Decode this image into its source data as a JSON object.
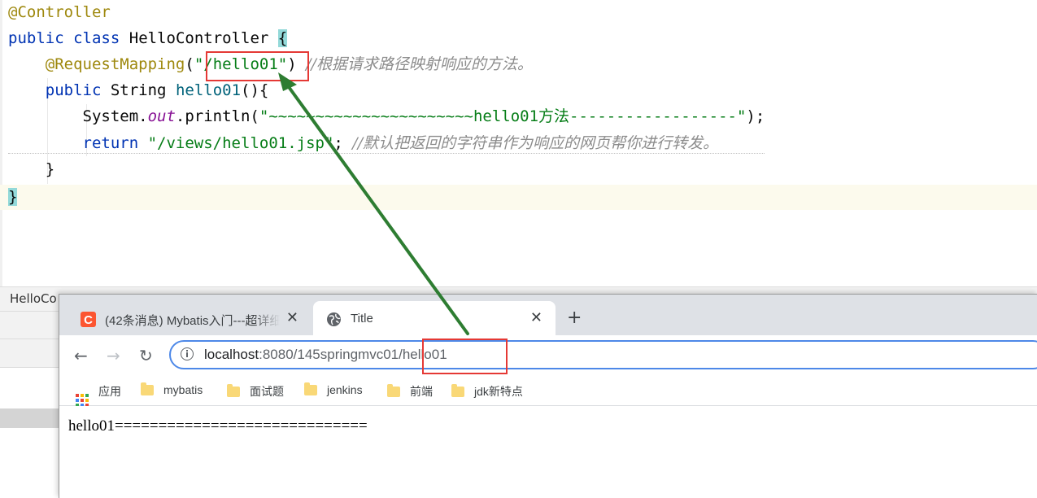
{
  "editor": {
    "lines": {
      "l1_annotation": "@Controller",
      "l2_kw_public": "public",
      "l2_kw_class": "class",
      "l2_name": "HelloController",
      "l2_brace": "{",
      "l3_annotation": "@RequestMapping",
      "l3_paren_open": "(",
      "l3_string": "\"/hello01\"",
      "l3_paren_close": ")",
      "l3_comment": "//根据请求路径映射响应的方法。",
      "l4_kw_public": "public",
      "l4_type": "String",
      "l4_method": "hello01",
      "l4_rest": "(){",
      "l5_system": "System.",
      "l5_out": "out",
      "l5_println": ".println(",
      "l5_string": "\"~~~~~~~~~~~~~~~~~~~~~~hello01方法------------------\"",
      "l5_end": ");",
      "l6_kw_return": "return",
      "l6_string": "\"/views/hello01.jsp\"",
      "l6_semicolon": ";",
      "l6_comment": "//默认把返回的字符串作为响应的网页帮你进行转发。",
      "l7_brace": "}",
      "l8_brace": "}"
    },
    "bottom_tab_label": "HelloCo"
  },
  "browser": {
    "tabs": [
      {
        "title": "(42条消息) Mybatis入门---超详细",
        "close": "✕",
        "favicon": "csdn-icon",
        "favicon_color": "#fc5531"
      },
      {
        "title": "Title",
        "close": "✕",
        "favicon": "globe-icon"
      }
    ],
    "new_tab": "+",
    "nav": {
      "back": "←",
      "forward": "→",
      "reload": "↻"
    },
    "url": {
      "host": "localhost",
      "rest": ":8080/145springmvc01/hello01"
    },
    "bookmarks": [
      {
        "label": "应用",
        "icon": "apps-icon"
      },
      {
        "label": "mybatis",
        "icon": "folder-icon"
      },
      {
        "label": "面试题",
        "icon": "folder-icon"
      },
      {
        "label": "jenkins",
        "icon": "folder-icon"
      },
      {
        "label": "前端",
        "icon": "folder-icon"
      },
      {
        "label": "jdk新特点",
        "icon": "folder-icon"
      }
    ],
    "page_body": "hello01============================="
  },
  "colors": {
    "highlight_box": "#e53935",
    "arrow": "#2e7d32",
    "omnibox_border": "#4d88e8"
  }
}
